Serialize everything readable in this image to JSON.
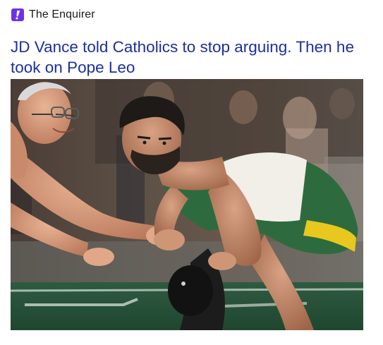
{
  "source": {
    "name": "The Enquirer",
    "logo_icon": "exclamation-logo-icon",
    "logo_color": "#6a34e8"
  },
  "headline": {
    "text": "JD Vance told Catholics to stop arguing. Then he took on Pope Leo",
    "color": "#1b2fa0"
  },
  "hero_image": {
    "description_icon": "wrestling-photo-image"
  }
}
